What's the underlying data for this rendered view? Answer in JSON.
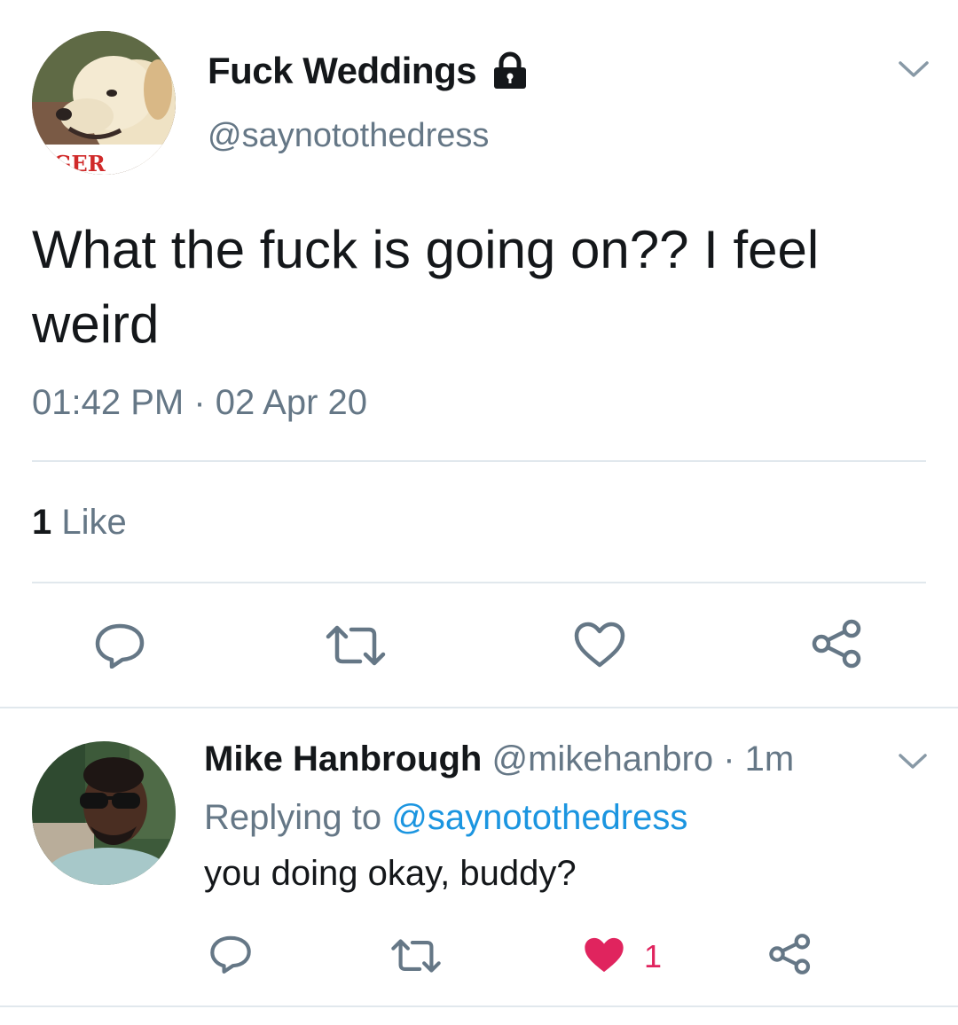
{
  "main_tweet": {
    "display_name": "Fuck Weddings",
    "handle": "@saynotothedress",
    "avatar_caption": "NGER",
    "text_line1": "What the fuck is going on?? I feel",
    "text_line2": "weird",
    "timestamp": "01:42 PM · 02 Apr 20",
    "likes_count": "1",
    "likes_label": "Like",
    "icons": [
      "reply-icon",
      "retweet-icon",
      "like-icon",
      "share-icon",
      "lock-icon",
      "chevron-down-icon"
    ]
  },
  "reply": {
    "display_name": "Mike Hanbrough",
    "handle": "@mikehanbro",
    "time": "· 1m",
    "replying_prefix": "Replying to",
    "replying_to": "@saynotothedress",
    "text": "you doing okay, buddy?",
    "like_count": "1",
    "like_color": "#e0245e",
    "icons": [
      "reply-icon",
      "retweet-icon",
      "like-filled-icon",
      "share-icon",
      "chevron-down-icon"
    ]
  },
  "colors": {
    "text": "#14171a",
    "muted": "#657786",
    "link": "#1b95e0",
    "divider": "#e1e8ed"
  }
}
